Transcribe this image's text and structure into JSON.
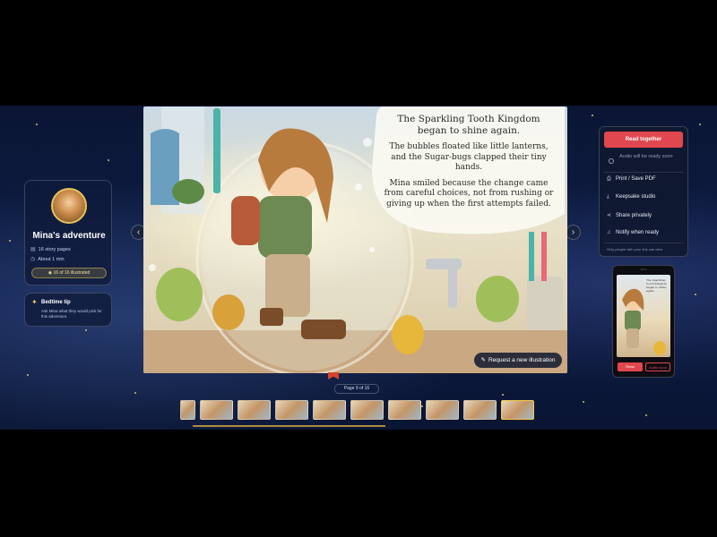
{
  "story": {
    "title": "Mina's adventure",
    "pages_label": "16 story pages",
    "duration_label": "About 1 min",
    "progress_label": "16 of 16 illustrated"
  },
  "tip": {
    "title": "Bedtime tip",
    "text": "Ask Mina what they would pick for this adventure."
  },
  "page": {
    "title": "The Sparkling Tooth Kingdom began to shine again.",
    "paragraphs": [
      "The bubbles floated like little lanterns, and the Sugar-bugs clapped their tiny hands.",
      "Mina smiled because the change came from careful choices, not from rushing or giving up when the first attempts failed."
    ],
    "request_label": "Request a new illustration",
    "indicator": "Page 9 of 16"
  },
  "thumbnails": {
    "count": 10,
    "active_index": 9
  },
  "actions": {
    "primary_label": "Read together",
    "audio_note": "Audio will be ready soon",
    "items": [
      {
        "label": "Print / Save PDF",
        "icon": "printer-icon"
      },
      {
        "label": "Keepsake studio",
        "icon": "keepsake-icon"
      },
      {
        "label": "Share privately",
        "icon": "share-icon"
      },
      {
        "label": "Notify when ready",
        "icon": "bell-icon"
      }
    ],
    "footnote": "Only people with your link can view"
  },
  "phone": {
    "read_label": "Read",
    "audio_label": "Audio soon",
    "text": "The Sparkling Tooth Kingdom began to shine again."
  },
  "colors": {
    "accent": "#e1474e",
    "gold": "#f2c94c",
    "panel": "#101830",
    "background": "#0d1c44"
  }
}
